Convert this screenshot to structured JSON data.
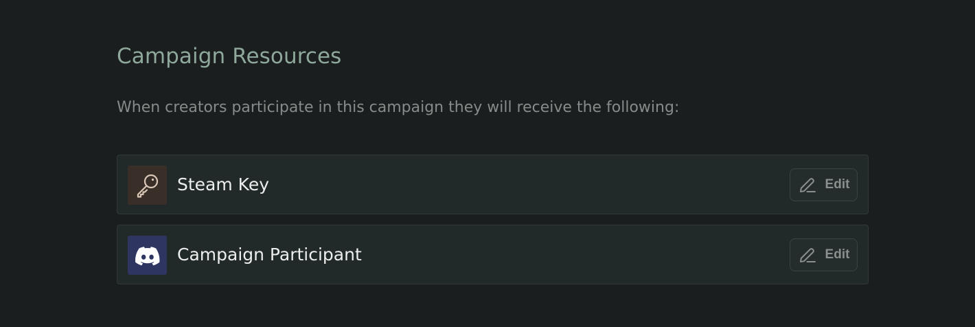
{
  "section": {
    "title": "Campaign Resources",
    "description": "When creators participate in this campaign they will receive the following:"
  },
  "resources": [
    {
      "label": "Steam Key",
      "icon": "key-icon",
      "icon_bg": "#3a2f28",
      "icon_color": "#d9c8b8",
      "edit_label": "Edit"
    },
    {
      "label": "Campaign Participant",
      "icon": "discord-icon",
      "icon_bg": "#2d3560",
      "icon_color": "#ffffff",
      "edit_label": "Edit"
    }
  ]
}
